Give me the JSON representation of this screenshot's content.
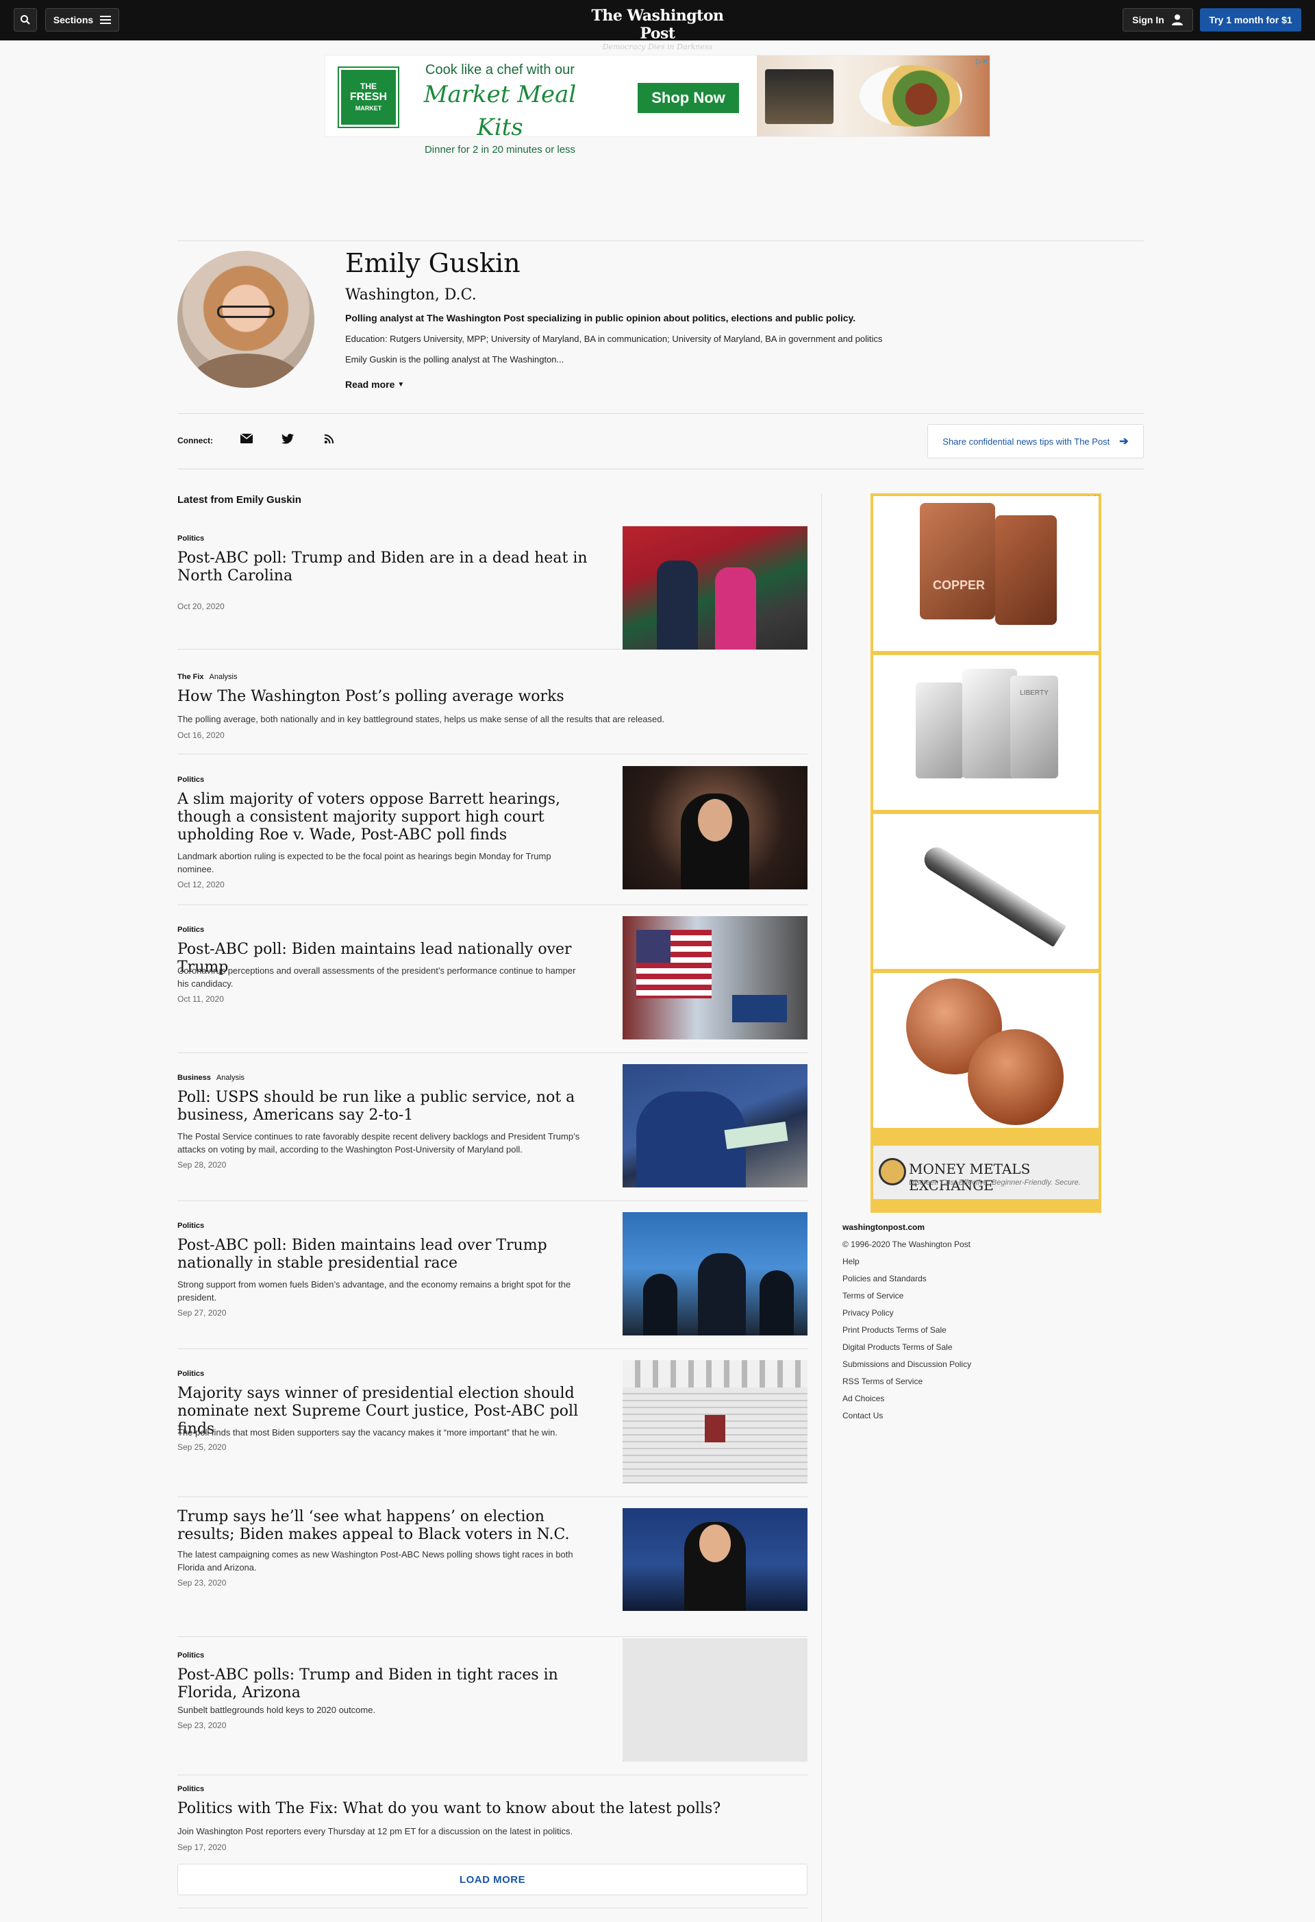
{
  "nav": {
    "sections_label": "Sections",
    "brand": "The Washington Post",
    "tagline": "Democracy Dies in Darkness",
    "signin_label": "Sign In",
    "subscribe_label": "Try 1 month for $1"
  },
  "top_ad": {
    "logo_line1": "THE",
    "logo_line2": "FRESH",
    "logo_line3": "MARKET",
    "headline1": "Cook like a chef with our",
    "headline2": "Market Meal Kits",
    "subline": "Dinner for 2 in 20 minutes or less",
    "cta": "Shop Now"
  },
  "profile": {
    "name": "Emily Guskin",
    "location": "Washington, D.C.",
    "title": "Polling analyst at The Washington Post specializing in public opinion about politics, elections and public policy.",
    "education": "Education: Rutgers University, MPP; University of Maryland, BA in communication; University of Maryland, BA in government and politics",
    "bio_snippet": "Emily Guskin is the polling analyst at The Washington...",
    "read_more": "Read more"
  },
  "connect": {
    "label": "Connect:",
    "tips_label": "Share confidential news tips with The Post"
  },
  "latest_title": "Latest from Emily Guskin",
  "articles": [
    {
      "kicker": "Politics",
      "kicker_sub": "",
      "headline": "Post-ABC poll: Trump and Biden are in a dead heat in North Carolina",
      "blurb": "",
      "date": "Oct 20, 2020"
    },
    {
      "kicker": "The Fix",
      "kicker_sub": "Analysis",
      "headline": "How The Washington Post’s polling average works",
      "blurb": "The polling average, both nationally and in key battleground states, helps us make sense of all the results that are released.",
      "date": "Oct 16, 2020"
    },
    {
      "kicker": "Politics",
      "kicker_sub": "",
      "headline": "A slim majority of voters oppose Barrett hearings, though a consistent majority support high court upholding Roe v. Wade, Post-ABC poll finds",
      "blurb": "Landmark abortion ruling is expected to be the focal point as hearings begin Monday for Trump nominee.",
      "date": "Oct 12, 2020"
    },
    {
      "kicker": "Politics",
      "kicker_sub": "",
      "headline": "Post-ABC poll: Biden maintains lead nationally over Trump",
      "blurb": "Coronavirus perceptions and overall assessments of the president’s performance continue to hamper his candidacy.",
      "date": "Oct 11, 2020"
    },
    {
      "kicker": "Business",
      "kicker_sub": "Analysis",
      "headline": "Poll: USPS should be run like a public service, not a business, Americans say 2-to-1",
      "blurb": "The Postal Service continues to rate favorably despite recent delivery backlogs and President Trump’s attacks on voting by mail, according to the Washington Post-University of Maryland poll.",
      "date": "Sep 28, 2020"
    },
    {
      "kicker": "Politics",
      "kicker_sub": "",
      "headline": "Post-ABC poll: Biden maintains lead over Trump nationally in stable presidential race",
      "blurb": "Strong support from women fuels Biden’s advantage, and the economy remains a bright spot for the president.",
      "date": "Sep 27, 2020"
    },
    {
      "kicker": "Politics",
      "kicker_sub": "",
      "headline": "Majority says winner of presidential election should nominate next Supreme Court justice, Post-ABC poll finds",
      "blurb": "The poll finds that most Biden supporters say the vacancy makes it “more important” that he win.",
      "date": "Sep 25, 2020"
    },
    {
      "kicker": "",
      "kicker_sub": "",
      "headline": "Trump says he’ll ‘see what happens’ on election results; Biden makes appeal to Black voters in N.C.",
      "blurb": "The latest campaigning comes as new Washington Post-ABC News polling shows tight races in both Florida and Arizona.",
      "date": "Sep 23, 2020"
    },
    {
      "kicker": "Politics",
      "kicker_sub": "",
      "headline": "Post-ABC polls: Trump and Biden in tight races in Florida, Arizona",
      "blurb": "Sunbelt battlegrounds hold keys to 2020 outcome.",
      "date": "Sep 23, 2020"
    },
    {
      "kicker": "Politics",
      "kicker_sub": "",
      "headline": "Politics with The Fix: What do you want to know about the latest polls?",
      "blurb": "Join Washington Post reporters every Thursday at 12 pm ET for a discussion on the latest in politics.",
      "date": "Sep 17, 2020"
    }
  ],
  "side_ad": {
    "brand": "MONEY METALS EXCHANGE",
    "tagline": "Discreet. Cost-Effective. Beginner-Friendly. Secure.",
    "copper_label": "COPPER",
    "coin_label": "LIBERTY"
  },
  "footer": {
    "site": "washingtonpost.com",
    "copyright": "© 1996-2020 The Washington Post",
    "links": [
      "Help",
      "Policies and Standards",
      "Terms of Service",
      "Privacy Policy",
      "Print Products Terms of Sale",
      "Digital Products Terms of Sale",
      "Submissions and Discussion Policy",
      "RSS Terms of Service",
      "Ad Choices",
      "Contact Us"
    ]
  },
  "load_more": "LOAD MORE"
}
